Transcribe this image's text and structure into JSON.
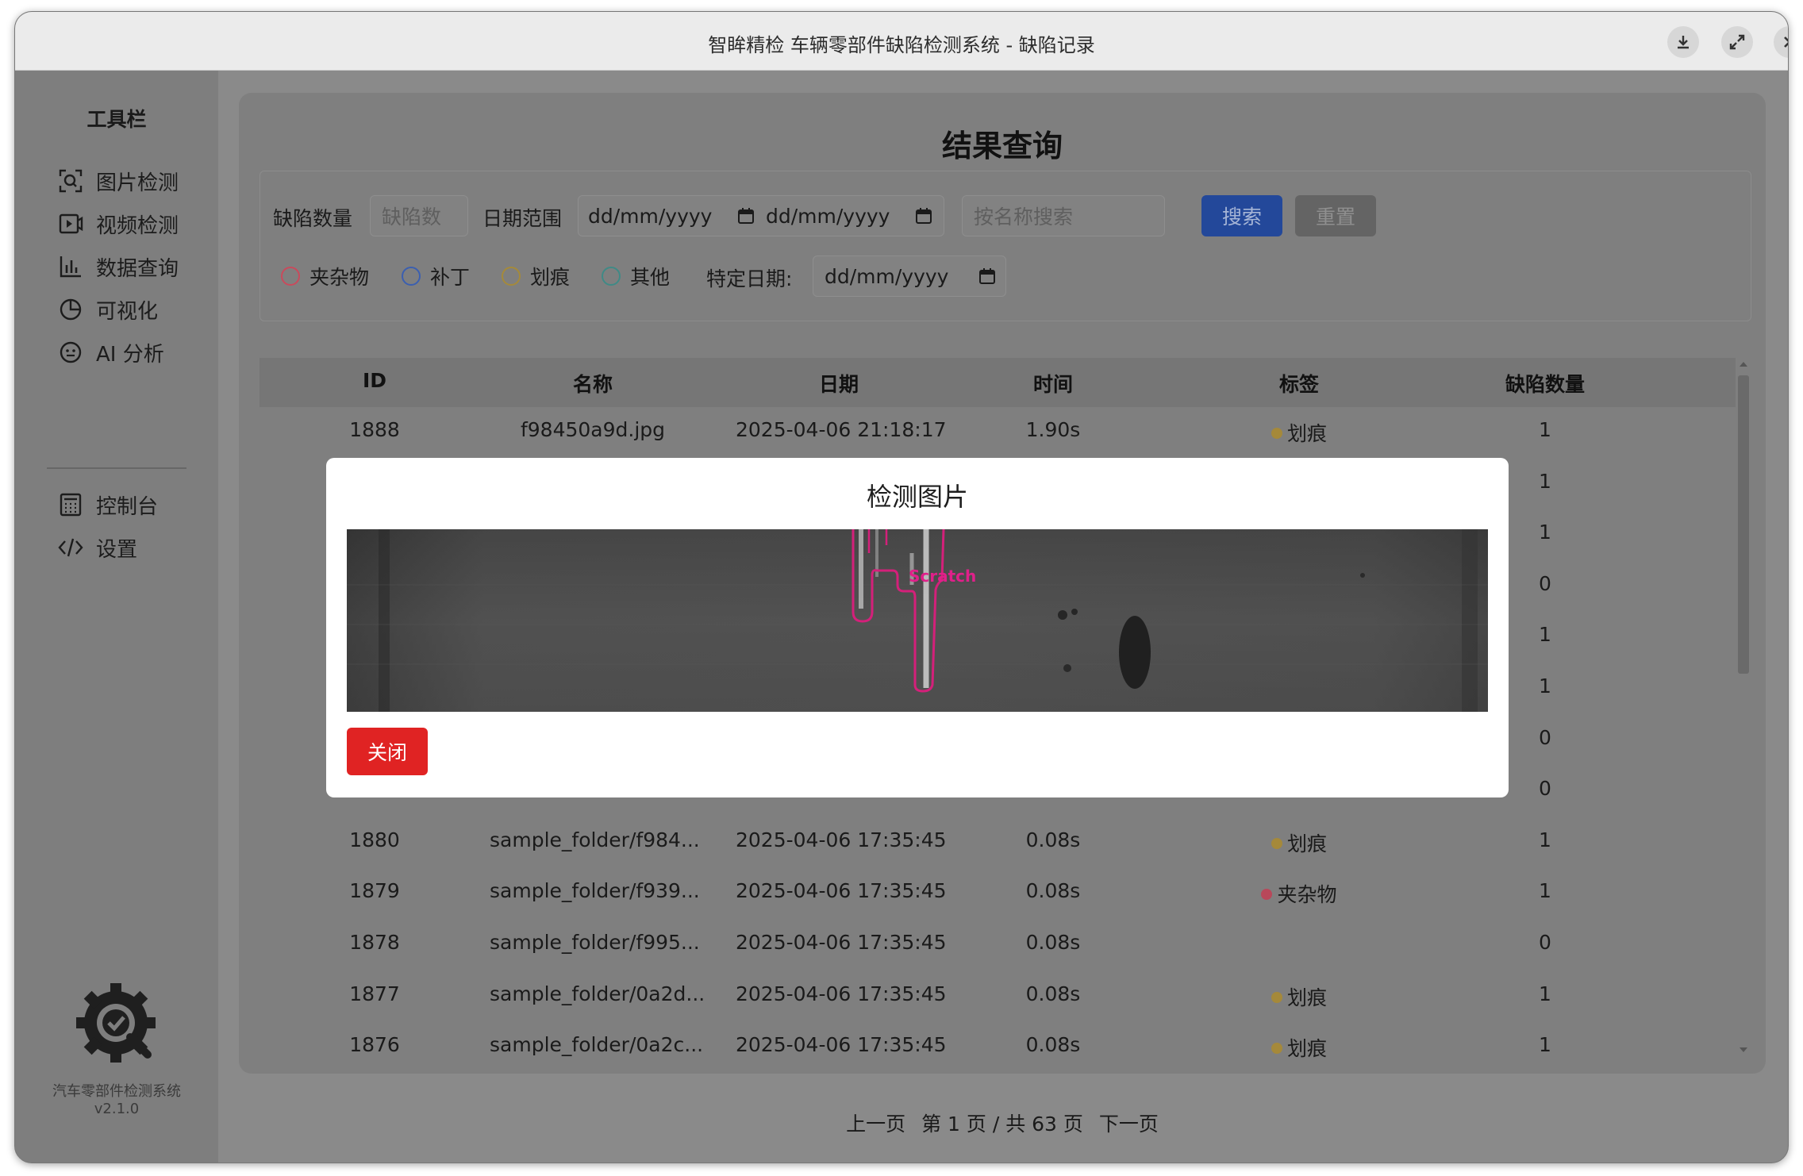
{
  "window": {
    "title": "智眸精检 车辆零部件缺陷检测系统 - 缺陷记录"
  },
  "sidebar": {
    "title": "工具栏",
    "items": [
      {
        "label": "图片检测",
        "icon": "image-scan-icon"
      },
      {
        "label": "视频检测",
        "icon": "video-icon"
      },
      {
        "label": "数据查询",
        "icon": "bar-chart-icon"
      },
      {
        "label": "可视化",
        "icon": "pie-chart-icon"
      },
      {
        "label": "AI 分析",
        "icon": "ai-face-icon"
      },
      {
        "label": "控制台",
        "icon": "calculator-icon"
      },
      {
        "label": "设置",
        "icon": "code-icon"
      }
    ],
    "footer_name": "汽车零部件检测系统",
    "footer_version": "v2.1.0"
  },
  "main": {
    "title": "结果查询",
    "filters": {
      "count_label": "缺陷数量",
      "count_placeholder": "缺陷数",
      "date_range_label": "日期范围",
      "date_start": "dd/mm/yyyy",
      "date_end": "dd/mm/yyyy",
      "name_placeholder": "按名称搜索",
      "search_button": "搜索",
      "reset_button": "重置",
      "types": [
        {
          "label": "夹杂物",
          "color": "#c94a5c"
        },
        {
          "label": "补丁",
          "color": "#3b5fb0"
        },
        {
          "label": "划痕",
          "color": "#a58a3a"
        },
        {
          "label": "其他",
          "color": "#3f8a86"
        }
      ],
      "specific_date_label": "特定日期:",
      "specific_date": "dd/mm/yyyy"
    },
    "table": {
      "headers": [
        "ID",
        "名称",
        "日期",
        "时间",
        "标签",
        "缺陷数量"
      ],
      "rows": [
        {
          "id": "1888",
          "name": "f98450a9d.jpg",
          "date": "2025-04-06 21:18:17",
          "time": "1.90s",
          "tag": "划痕",
          "tag_color": "#a5893a",
          "count": "1"
        },
        {
          "id": "",
          "name": "",
          "date": "",
          "time": "",
          "tag": "",
          "tag_color": "",
          "count": "1"
        },
        {
          "id": "",
          "name": "",
          "date": "",
          "time": "",
          "tag": "",
          "tag_color": "",
          "count": "1"
        },
        {
          "id": "",
          "name": "",
          "date": "",
          "time": "",
          "tag": "",
          "tag_color": "",
          "count": "0"
        },
        {
          "id": "",
          "name": "",
          "date": "",
          "time": "",
          "tag": "",
          "tag_color": "",
          "count": "1"
        },
        {
          "id": "",
          "name": "",
          "date": "",
          "time": "",
          "tag": "",
          "tag_color": "",
          "count": "1"
        },
        {
          "id": "",
          "name": "",
          "date": "",
          "time": "",
          "tag": "",
          "tag_color": "",
          "count": "0"
        },
        {
          "id": "",
          "name": "",
          "date": "",
          "time": "",
          "tag": "",
          "tag_color": "",
          "count": "0"
        },
        {
          "id": "1880",
          "name": "sample_folder/f984...",
          "date": "2025-04-06 17:35:45",
          "time": "0.08s",
          "tag": "划痕",
          "tag_color": "#a5893a",
          "count": "1"
        },
        {
          "id": "1879",
          "name": "sample_folder/f939...",
          "date": "2025-04-06 17:35:45",
          "time": "0.08s",
          "tag": "夹杂物",
          "tag_color": "#b8485a",
          "count": "1"
        },
        {
          "id": "1878",
          "name": "sample_folder/f995...",
          "date": "2025-04-06 17:35:45",
          "time": "0.08s",
          "tag": "",
          "tag_color": "",
          "count": "0"
        },
        {
          "id": "1877",
          "name": "sample_folder/0a2d...",
          "date": "2025-04-06 17:35:45",
          "time": "0.08s",
          "tag": "划痕",
          "tag_color": "#a5893a",
          "count": "1"
        },
        {
          "id": "1876",
          "name": "sample_folder/0a2c...",
          "date": "2025-04-06 17:35:45",
          "time": "0.08s",
          "tag": "划痕",
          "tag_color": "#a5893a",
          "count": "1"
        }
      ]
    },
    "pager": {
      "prev": "上一页",
      "info": "第 1 页 / 共 63 页",
      "next": "下一页"
    }
  },
  "modal": {
    "title": "检测图片",
    "image_label": "Scratch",
    "close_button": "关闭"
  }
}
